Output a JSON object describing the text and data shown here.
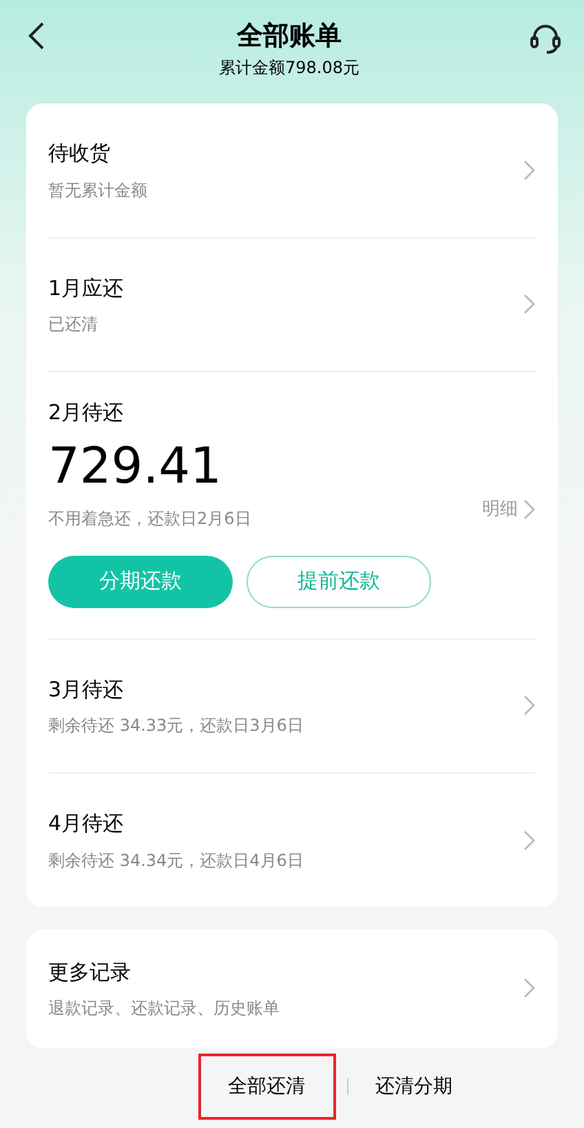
{
  "header": {
    "title": "全部账单",
    "subtitle": "累计金额798.08元"
  },
  "bills": [
    {
      "kind": "simple",
      "title": "待收货",
      "note": "暂无累计金额"
    },
    {
      "kind": "simple",
      "title": "1月应还",
      "note": "已还清"
    },
    {
      "kind": "current",
      "title": "2月待还",
      "amount": "729.41",
      "note": "不用着急还，还款日2月6日",
      "detail": "明细",
      "buttons": [
        {
          "label": "分期还款",
          "primary": true
        },
        {
          "label": "提前还款",
          "primary": false
        }
      ]
    },
    {
      "kind": "simple",
      "title": "3月待还",
      "note": "剩余待还 34.33元，还款日3月6日"
    },
    {
      "kind": "simple",
      "title": "4月待还",
      "note": "剩余待还 34.34元，还款日4月6日"
    }
  ],
  "more": {
    "title": "更多记录",
    "note": "退款记录、还款记录、历史账单"
  },
  "footer": [
    {
      "label": "全部还清",
      "highlighted": true
    },
    {
      "label": "还清分期",
      "highlighted": false
    }
  ]
}
